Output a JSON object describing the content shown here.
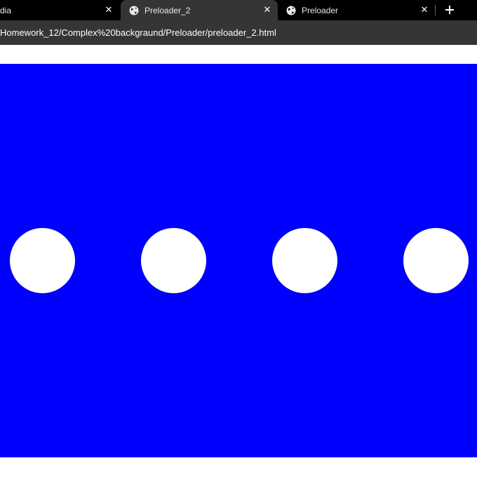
{
  "tabs": [
    {
      "title": "dia",
      "active": false
    },
    {
      "title": "Preloader_2",
      "active": true
    },
    {
      "title": "Preloader",
      "active": false
    }
  ],
  "address_bar": {
    "url": "Homework_12/Complex%20backgraund/Preloader/preloader_2.html"
  },
  "page": {
    "background_color": "#0000ff",
    "dot_color": "#ffffff",
    "dot_count": 4
  },
  "icons": {
    "tab_favicon": "globe-icon",
    "tab_close": "close-icon",
    "new_tab": "plus-icon"
  }
}
